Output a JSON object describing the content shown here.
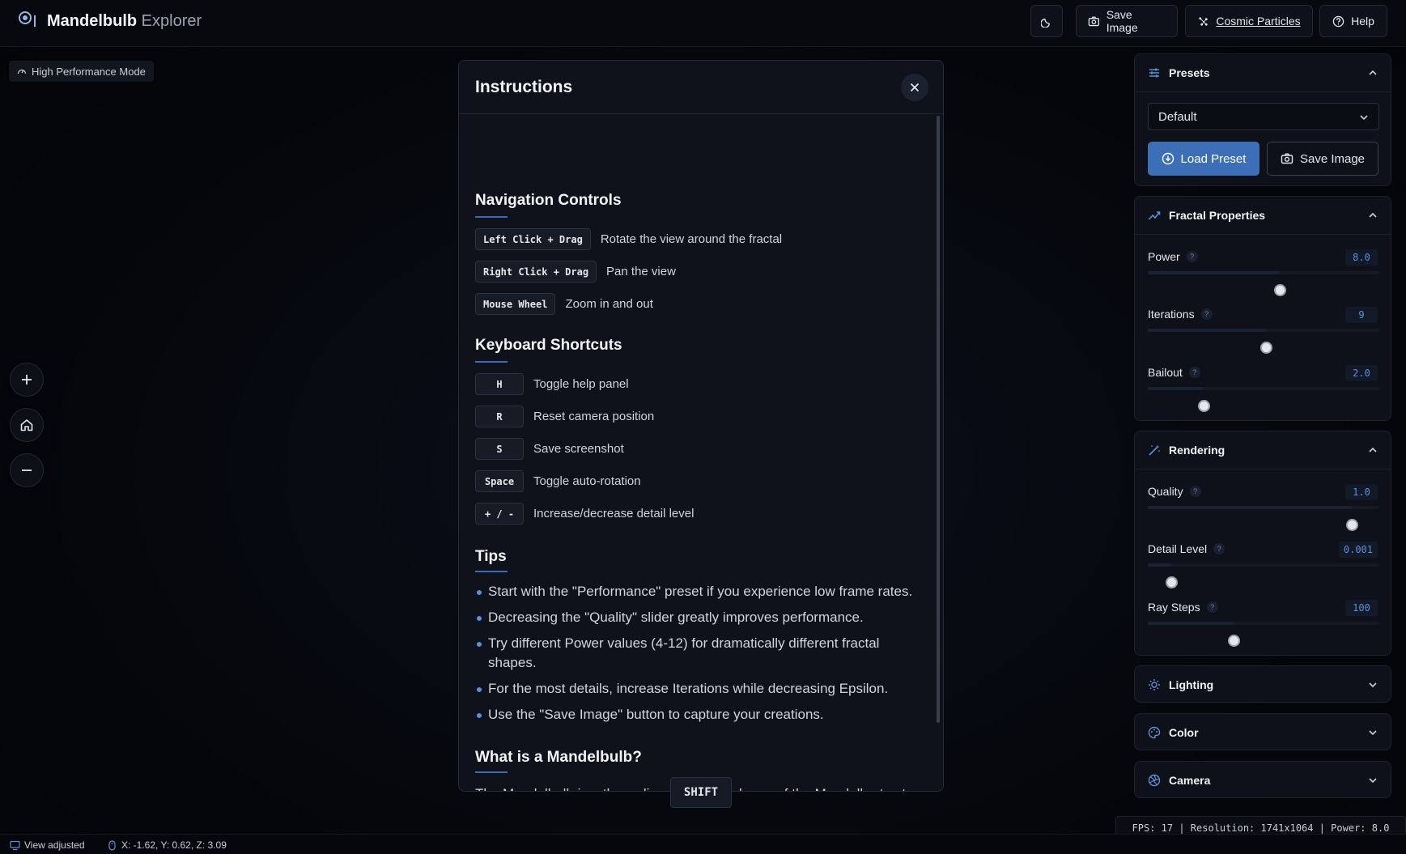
{
  "header": {
    "title_main": "Mandelbulb",
    "title_sub": "Explorer",
    "theme_icon": "moon-icon",
    "save_image_label": "Save Image",
    "cosmic_particles_label": "Cosmic Particles",
    "help_label": "Help"
  },
  "perf_badge": "High Performance Mode",
  "modal": {
    "title": "Instructions",
    "nav_title": "Navigation Controls",
    "nav": [
      {
        "key": "Left Click + Drag",
        "desc": "Rotate the view around the fractal"
      },
      {
        "key": "Right Click + Drag",
        "desc": "Pan the view"
      },
      {
        "key": "Mouse Wheel",
        "desc": "Zoom in and out"
      }
    ],
    "kb_title": "Keyboard Shortcuts",
    "kb": [
      {
        "key": "H",
        "desc": "Toggle help panel"
      },
      {
        "key": "R",
        "desc": "Reset camera position"
      },
      {
        "key": "S",
        "desc": "Save screenshot"
      },
      {
        "key": "Space",
        "desc": "Toggle auto-rotation"
      },
      {
        "key": "+ / -",
        "desc": "Increase/decrease detail level"
      }
    ],
    "tips_title": "Tips",
    "tips": [
      "Start with the \"Performance\" preset if you experience low frame rates.",
      "Decreasing the \"Quality\" slider greatly improves performance.",
      "Try different Power values (4-12) for dramatically different fractal shapes.",
      "For the most details, increase Iterations while decreasing Epsilon.",
      "Use the \"Save Image\" button to capture your creations."
    ],
    "what_title": "What is a Mandelbulb?",
    "what_text": "The Mandelbulb is a three-dimensional analogue of the Mandelbrot set, constructed using spherical coordinates. It was discovered by Daniel White and Paul Nylander in 2009. The explorer allows you to visualize"
  },
  "shift_badge": "SHIFT",
  "panels": {
    "presets": {
      "title": "Presets",
      "selected": "Default",
      "load_label": "Load Preset",
      "save_label": "Save Image"
    },
    "fractal": {
      "title": "Fractal Properties",
      "sliders": [
        {
          "label": "Power",
          "value": "8.0",
          "fraction": 0.57
        },
        {
          "label": "Iterations",
          "value": "9",
          "fraction": 0.51
        },
        {
          "label": "Bailout",
          "value": "2.0",
          "fraction": 0.24
        }
      ]
    },
    "rendering": {
      "title": "Rendering",
      "sliders": [
        {
          "label": "Quality",
          "value": "1.0",
          "fraction": 0.88
        },
        {
          "label": "Detail Level",
          "value": "0.001",
          "fraction": 0.1
        },
        {
          "label": "Ray Steps",
          "value": "100",
          "fraction": 0.37
        }
      ]
    },
    "lighting": {
      "title": "Lighting"
    },
    "color": {
      "title": "Color"
    },
    "camera": {
      "title": "Camera"
    }
  },
  "fps_text": "FPS: 17 | Resolution: 1741x1064 | Power: 8.0",
  "status": {
    "view": "View adjusted",
    "coords": "X: -1.62, Y: 0.62, Z: 3.09"
  },
  "colors": {
    "accent": "#3b6cb7",
    "load_button": "#3d6fb8",
    "value_text": "#5f8fd6"
  }
}
